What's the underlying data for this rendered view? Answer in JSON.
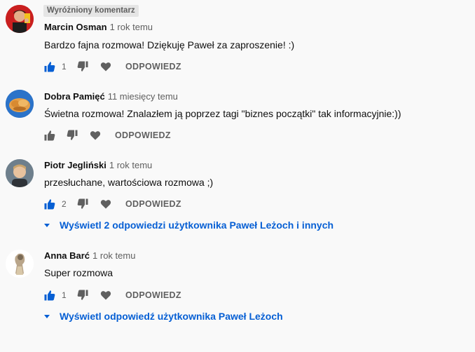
{
  "comments": [
    {
      "pinned_label": "Wyróżniony komentarz",
      "author": "Marcin Osman",
      "time": "1 rok temu",
      "text": "Bardzo fajna rozmowa! Dziękuję Paweł za zaproszenie! :)",
      "likes": "1",
      "reply_label": "ODPOWIEDZ"
    },
    {
      "author": "Dobra Pamięć",
      "time": "11 miesięcy temu",
      "text": "Świetna rozmowa! Znalazłem ją poprzez tagi \"biznes początki\" tak informacyjnie:))",
      "likes": "",
      "reply_label": "ODPOWIEDZ"
    },
    {
      "author": "Piotr Jegliński",
      "time": "1 rok temu",
      "text": "przesłuchane, wartościowa rozmowa ;)",
      "likes": "2",
      "reply_label": "ODPOWIEDZ",
      "replies_link": "Wyświetl 2 odpowiedzi użytkownika Paweł Leżoch i innych"
    },
    {
      "author": "Anna Barć",
      "time": "1 rok temu",
      "text": "Super rozmowa",
      "likes": "1",
      "reply_label": "ODPOWIEDZ",
      "replies_link": "Wyświetl odpowiedź użytkownika Paweł Leżoch"
    }
  ],
  "icons": {
    "like": "thumbs-up-icon",
    "dislike": "thumbs-down-icon",
    "heart": "heart-icon",
    "expand": "caret-down-icon"
  },
  "colors": {
    "like_active": "#065fd4",
    "link": "#065fd4",
    "muted": "#606060",
    "background": "#f9f9f9"
  }
}
